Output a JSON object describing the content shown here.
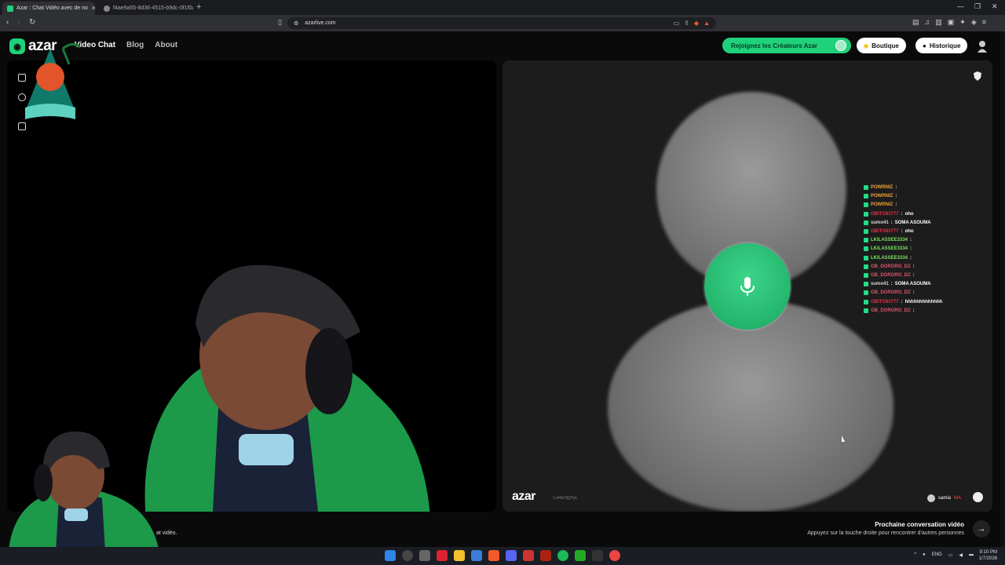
{
  "browser": {
    "tabs": [
      {
        "label": "Azar : Chat Vidéo avec de no"
      },
      {
        "label": "f4ae9a55-8d36-4515-b9dc-0f1f0a65"
      }
    ],
    "url": "azarlive.com"
  },
  "site": {
    "logo_text": "azar",
    "nav": [
      {
        "label": "Video Chat"
      },
      {
        "label": "Blog"
      },
      {
        "label": "About"
      }
    ],
    "creators_button": "Rejoignez les Créateurs Azar",
    "shop_button": "Boutique",
    "history_button": "Historique"
  },
  "remote_panel": {
    "watermark": "azar",
    "session_id": "1-nHx73QYyL",
    "peer_name": "samia",
    "peer_country": "MA"
  },
  "chat": [
    {
      "user": "POWRNIZ",
      "msg": "",
      "color": "#f0a13a"
    },
    {
      "user": "POWRNIZ",
      "msg": "",
      "color": "#f0a13a"
    },
    {
      "user": "POWRNIZ",
      "msg": "",
      "color": "#f0a13a"
    },
    {
      "user": "OBITO83777",
      "msg": "oho",
      "color": "#d8334a"
    },
    {
      "user": "sumo41",
      "msg": "SOMA ASOUMA",
      "color": "#d9d9d9"
    },
    {
      "user": "OBITO83777",
      "msg": "oho",
      "color": "#d8334a"
    },
    {
      "user": "LKILASSEE3334",
      "msg": "",
      "color": "#7be35a"
    },
    {
      "user": "LKILASSEE3334",
      "msg": "",
      "color": "#7be35a"
    },
    {
      "user": "LKILASSEE3334",
      "msg": "",
      "color": "#7be35a"
    },
    {
      "user": "GB_DORORO_DZ",
      "msg": "",
      "color": "#e0556a"
    },
    {
      "user": "GB_DORORO_DZ",
      "msg": "",
      "color": "#e0556a"
    },
    {
      "user": "sumo41",
      "msg": "SOMA ASOUMA",
      "color": "#d9d9d9"
    },
    {
      "user": "GB_DORORO_DZ",
      "msg": "",
      "color": "#e0556a"
    },
    {
      "user": "OBITO83777",
      "msg": "hhhhhhhhhhhhh",
      "color": "#d8334a"
    },
    {
      "user": "GB_DORORO_DZ",
      "msg": "",
      "color": "#e0556a"
    }
  ],
  "footer": {
    "note": "at vidéo.",
    "next_title": "Prochaine conversation vidéo",
    "next_sub": "Appuyez sur la touche droite pour rencontrer d'autres personnes"
  },
  "taskbar": {
    "lang": "ENG",
    "time": "9:10 PM",
    "date": "1/7/2026"
  },
  "colors": {
    "accent": "#1fd17a"
  }
}
